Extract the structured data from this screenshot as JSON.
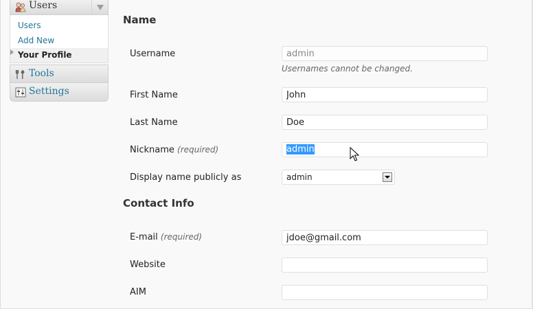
{
  "sidebar": {
    "users_label": "Users",
    "sub_items": [
      {
        "label": "Users"
      },
      {
        "label": "Add New"
      },
      {
        "label": "Your Profile"
      }
    ],
    "tools_label": "Tools",
    "settings_label": "Settings"
  },
  "form": {
    "name_section": "Name",
    "username": {
      "label": "Username",
      "value": "admin",
      "hint": "Usernames cannot be changed."
    },
    "first_name": {
      "label": "First Name",
      "value": "John"
    },
    "last_name": {
      "label": "Last Name",
      "value": "Doe"
    },
    "nickname": {
      "label": "Nickname",
      "required": "(required)",
      "value": "admin"
    },
    "display_name": {
      "label": "Display name publicly as",
      "value": "admin"
    },
    "contact_section": "Contact Info",
    "email": {
      "label": "E-mail",
      "required": "(required)",
      "value": "jdoe@gmail.com"
    },
    "website": {
      "label": "Website",
      "value": ""
    },
    "aim": {
      "label": "AIM",
      "value": ""
    }
  },
  "colors": {
    "link": "#21759b",
    "selection": "#3399ff",
    "background": "#f9f9f9"
  }
}
